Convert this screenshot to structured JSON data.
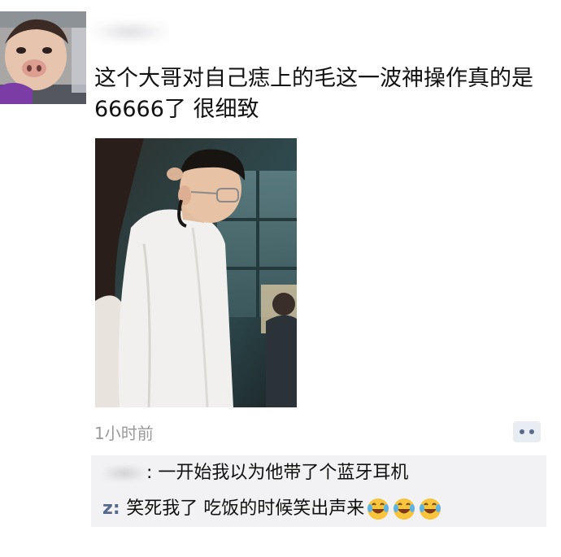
{
  "post": {
    "author_name": "",
    "text": "这个大哥对自己痣上的毛这一波神操作真的是66666了 很细致",
    "time": "1小时前"
  },
  "comments": [
    {
      "author": "",
      "separator": ": ",
      "text": "一开始我以为他带了个蓝牙耳机"
    },
    {
      "author": "z",
      "separator": ": ",
      "text": "笑死我了 吃饭的时候笑出声来",
      "emojis": [
        "laugh-cry-emoji",
        "laugh-cry-emoji",
        "laugh-cry-emoji"
      ]
    }
  ],
  "colors": {
    "commenter": "#56698f",
    "time": "#9a9a9a",
    "comment_bg": "#f2f2f4",
    "more_button_bg": "#e8ecf3"
  }
}
